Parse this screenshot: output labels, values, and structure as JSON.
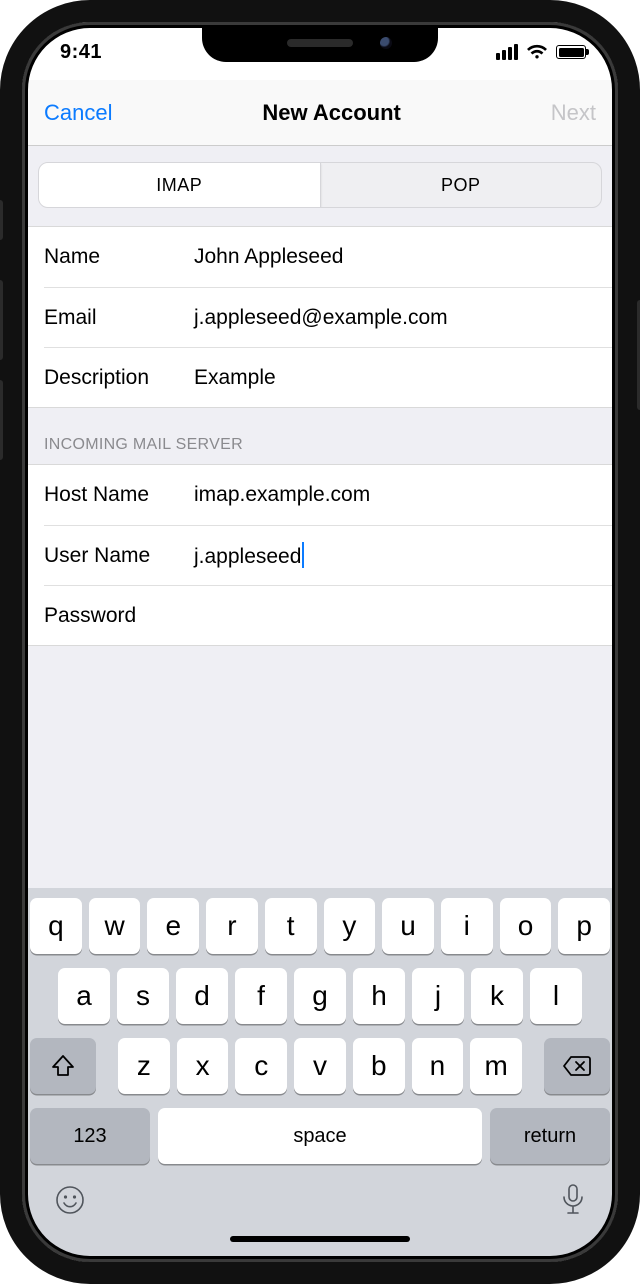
{
  "status": {
    "time": "9:41"
  },
  "nav": {
    "cancel": "Cancel",
    "title": "New Account",
    "next": "Next"
  },
  "segmented": {
    "imap": "IMAP",
    "pop": "POP"
  },
  "fields": {
    "name": {
      "label": "Name",
      "value": "John Appleseed"
    },
    "email": {
      "label": "Email",
      "value": "j.appleseed@example.com"
    },
    "description": {
      "label": "Description",
      "value": "Example"
    }
  },
  "section_header": "INCOMING MAIL SERVER",
  "incoming": {
    "hostname": {
      "label": "Host Name",
      "value": "imap.example.com"
    },
    "username": {
      "label": "User Name",
      "value": "j.appleseed"
    },
    "password": {
      "label": "Password",
      "value": ""
    }
  },
  "keyboard": {
    "row1": [
      "q",
      "w",
      "e",
      "r",
      "t",
      "y",
      "u",
      "i",
      "o",
      "p"
    ],
    "row2": [
      "a",
      "s",
      "d",
      "f",
      "g",
      "h",
      "j",
      "k",
      "l"
    ],
    "row3": [
      "z",
      "x",
      "c",
      "v",
      "b",
      "n",
      "m"
    ],
    "numbers": "123",
    "space": "space",
    "return": "return"
  }
}
